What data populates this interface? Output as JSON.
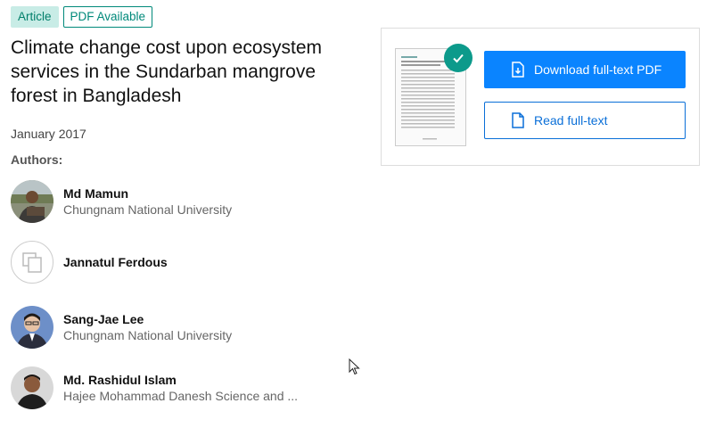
{
  "badges": {
    "article": "Article",
    "pdf": "PDF Available"
  },
  "title": "Climate change cost upon ecosystem services in the Sundarban mangrove forest in Bangladesh",
  "date": "January 2017",
  "authors_label": "Authors:",
  "authors": [
    {
      "name": "Md Mamun",
      "affiliation": "Chungnam National University",
      "avatar": "photo"
    },
    {
      "name": "Jannatul Ferdous",
      "affiliation": "",
      "avatar": "placeholder-icon"
    },
    {
      "name": "Sang-Jae Lee",
      "affiliation": "Chungnam National University",
      "avatar": "photo"
    },
    {
      "name": "Md. Rashidul Islam",
      "affiliation": "Hajee Mohammad Danesh Science and ...",
      "avatar": "photo"
    }
  ],
  "pdf_card": {
    "download_label": "Download full-text PDF",
    "read_label": "Read full-text",
    "download_icon": "file-download-icon",
    "read_icon": "file-icon",
    "check_icon": "check-icon"
  },
  "colors": {
    "accent_blue": "#0a84ff",
    "teal": "#0c9a8b",
    "badge_bg": "#c8ece6"
  }
}
